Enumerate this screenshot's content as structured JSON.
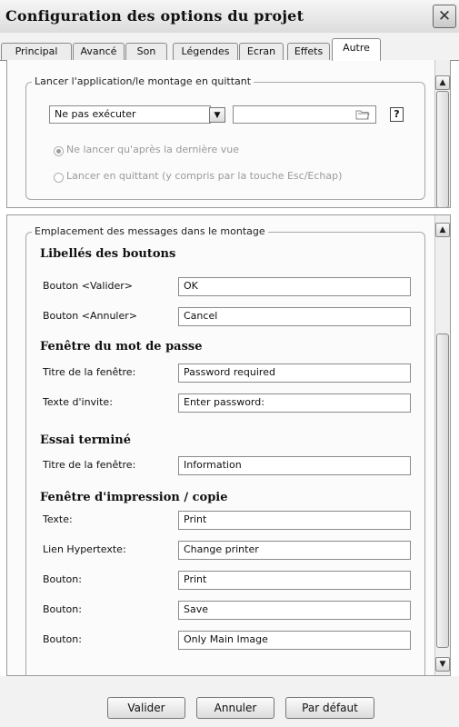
{
  "window": {
    "title": "Configuration des options du projet"
  },
  "tabs": [
    "Principal",
    "Avancé",
    "Son",
    "Légendes",
    "Ecran",
    "Effets",
    "Autre"
  ],
  "launch_group": {
    "legend": "Lancer l'application/le montage en quittant",
    "select_value": "Ne pas exécuter",
    "path_value": "",
    "help_label": "?",
    "radio_after_last": "Ne lancer qu'après la dernière vue",
    "radio_on_quit": "Lancer en quittant (y compris par la touche Esc/Echap)"
  },
  "messages_group": {
    "legend": "Emplacement des messages dans le montage",
    "buttons_section": {
      "heading": "Libellés des boutons",
      "validate_label": "Bouton <Valider>",
      "validate_value": "OK",
      "cancel_label": "Bouton <Annuler>",
      "cancel_value": "Cancel"
    },
    "password_section": {
      "heading": "Fenêtre du mot de passe",
      "window_title_label": "Titre de la fenêtre:",
      "window_title_value": "Password required",
      "prompt_label": "Texte d'invite:",
      "prompt_value": "Enter password:"
    },
    "trial_section": {
      "heading": "Essai terminé",
      "window_title_label": "Titre de la fenêtre:",
      "window_title_value": "Information"
    },
    "print_section": {
      "heading": "Fenêtre d'impression / copie",
      "text_label": "Texte:",
      "text_value": "Print",
      "hyperlink_label": "Lien Hypertexte:",
      "hyperlink_value": "Change printer",
      "button1_label": "Bouton:",
      "button1_value": "Print",
      "button2_label": "Bouton:",
      "button2_value": "Save",
      "button3_label": "Bouton:",
      "button3_value": "Only Main Image"
    }
  },
  "footer": {
    "ok_label": "Valider",
    "cancel_label": "Annuler",
    "default_label": "Par défaut"
  },
  "icons": {
    "close": "✕",
    "dropdown": "▼",
    "folder": "folder-open-icon",
    "scroll_up": "▲",
    "scroll_down": "▼"
  }
}
